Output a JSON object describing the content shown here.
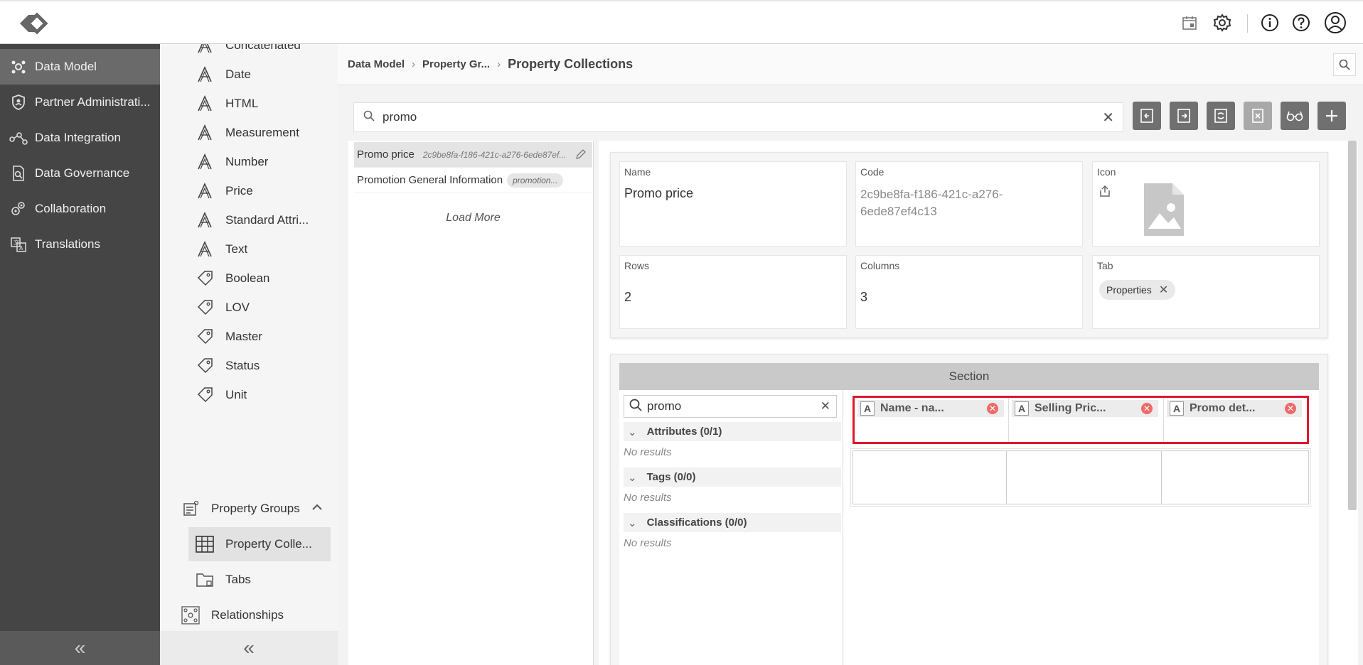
{
  "sidebar": {
    "items": [
      {
        "label": "Data Model",
        "icon": "data-model-icon"
      },
      {
        "label": "Partner Administrati...",
        "icon": "shield-icon"
      },
      {
        "label": "Data Integration",
        "icon": "integration-icon"
      },
      {
        "label": "Data Governance",
        "icon": "governance-icon"
      },
      {
        "label": "Collaboration",
        "icon": "collaboration-icon"
      },
      {
        "label": "Translations",
        "icon": "translations-icon"
      }
    ],
    "collapse": "«"
  },
  "subnav": {
    "items": [
      {
        "label": "Concatenated",
        "icon": "attribute-icon"
      },
      {
        "label": "Date",
        "icon": "attribute-icon"
      },
      {
        "label": "HTML",
        "icon": "attribute-icon"
      },
      {
        "label": "Measurement",
        "icon": "attribute-icon"
      },
      {
        "label": "Number",
        "icon": "attribute-icon"
      },
      {
        "label": "Price",
        "icon": "attribute-icon"
      },
      {
        "label": "Standard Attri...",
        "icon": "attribute-icon"
      },
      {
        "label": "Text",
        "icon": "attribute-icon"
      },
      {
        "label": "Boolean",
        "icon": "tag-icon"
      },
      {
        "label": "LOV",
        "icon": "tag-icon"
      },
      {
        "label": "Master",
        "icon": "tag-icon"
      },
      {
        "label": "Status",
        "icon": "tag-icon"
      },
      {
        "label": "Unit",
        "icon": "tag-icon"
      }
    ],
    "property_groups": "Property Groups",
    "property_collections": "Property Colle...",
    "tabs": "Tabs",
    "relationships": "Relationships",
    "collapse": "«"
  },
  "breadcrumb": {
    "items": [
      "Data Model",
      "Property Gr..."
    ],
    "current": "Property Collections"
  },
  "search": {
    "value": "promo",
    "clear": "✕"
  },
  "list": {
    "rows": [
      {
        "name": "Promo price",
        "code": "2c9be8fa-f186-421c-a276-6ede87ef..."
      },
      {
        "name": "Promotion General Information",
        "chip": "promotion..."
      }
    ],
    "load_more": "Load More"
  },
  "detail": {
    "name_label": "Name",
    "name_value": "Promo price",
    "code_label": "Code",
    "code_value": "2c9be8fa-f186-421c-a276-6ede87ef4c13",
    "icon_label": "Icon",
    "rows_label": "Rows",
    "rows_value": "2",
    "columns_label": "Columns",
    "columns_value": "3",
    "tab_label": "Tab",
    "tab_chip": "Properties",
    "tab_chip_remove": "✕"
  },
  "section": {
    "title": "Section",
    "search_value": "promo",
    "search_clear": "✕",
    "groups": [
      {
        "label": "Attributes (0/1)",
        "empty": "No results"
      },
      {
        "label": "Tags (0/0)",
        "empty": "No results"
      },
      {
        "label": "Classifications (0/0)",
        "empty": "No results"
      }
    ],
    "cells": [
      {
        "label": "Name - na...",
        "type": "A"
      },
      {
        "label": "Selling Pric...",
        "type": "A"
      },
      {
        "label": "Promo det...",
        "type": "A"
      }
    ]
  },
  "colors": {
    "nav_bg": "#454545",
    "nav_active": "#6a6a6a",
    "highlight": "#e0182d",
    "tool_btn": "#707070"
  }
}
